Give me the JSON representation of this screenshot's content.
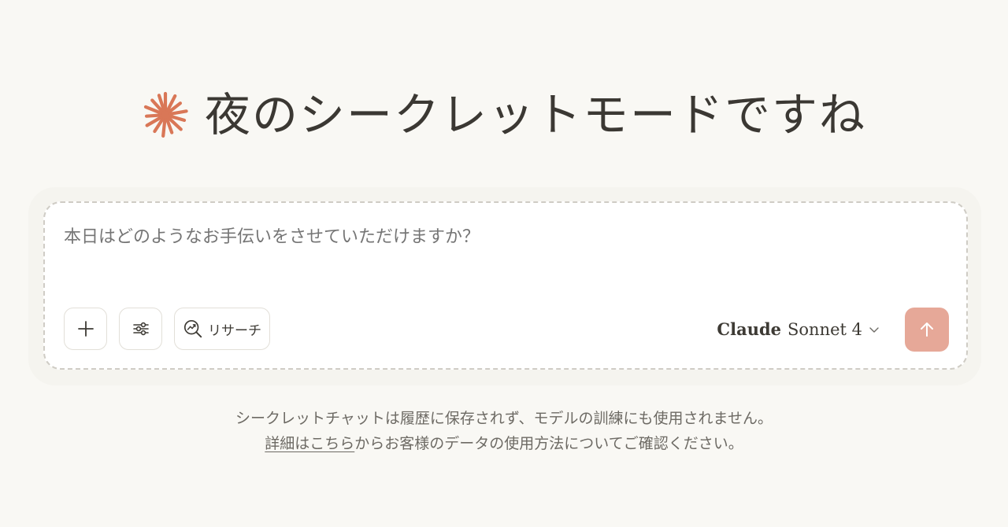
{
  "greeting": {
    "logo_icon": "claude-sparkle-icon",
    "title": "夜のシークレットモードですね"
  },
  "composer": {
    "placeholder": "本日はどのようなお手伝いをさせていただけますか？",
    "add_button_icon": "plus-icon",
    "tools_button_icon": "sliders-icon",
    "research_button": {
      "icon": "research-magnifier-icon",
      "label": "リサーチ"
    },
    "model_selector": {
      "brand": "Claude",
      "model": "Sonnet 4",
      "icon": "chevron-down-icon"
    },
    "send_button_icon": "arrow-up-icon"
  },
  "notice": {
    "line1": "シークレットチャットは履歴に保存されず、モデルの訓練にも使用されません。",
    "link_text": "詳細はこちら",
    "line2_rest": "からお客様のデータの使用方法についてご確認ください。"
  },
  "colors": {
    "background": "#f9f8f4",
    "accent": "#d97757",
    "send_button": "#e6a898",
    "text": "#3d3a34",
    "muted_text": "#6d6a64"
  }
}
